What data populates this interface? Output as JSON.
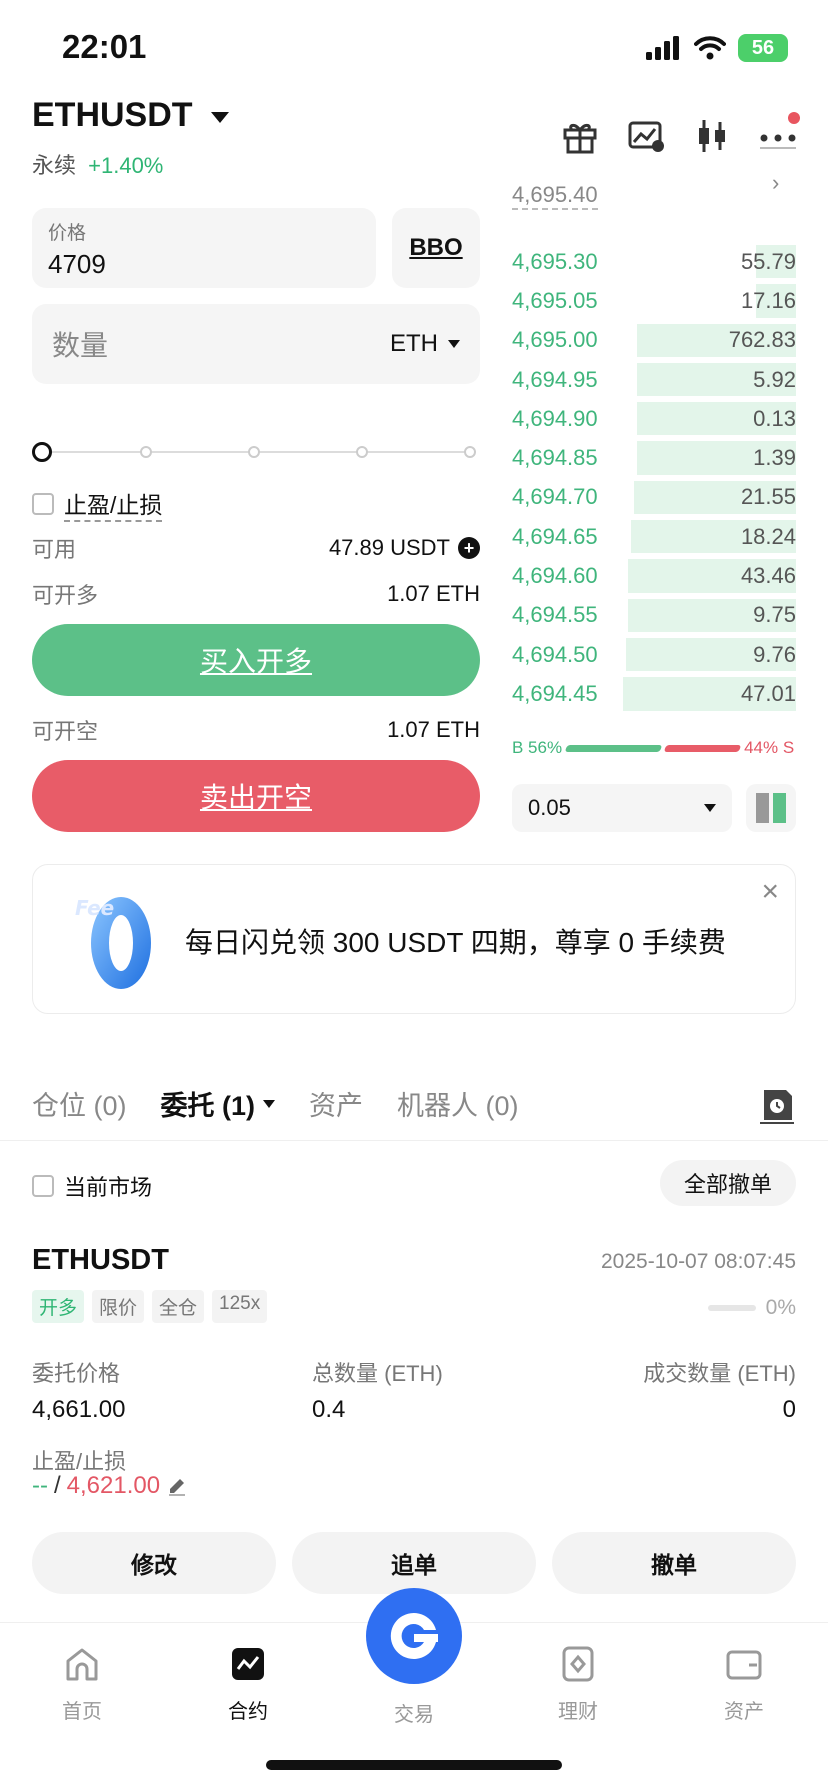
{
  "status": {
    "time": "22:01",
    "battery": "56"
  },
  "header": {
    "symbol": "ETHUSDT",
    "contract_type": "永续",
    "change": "+1.40%"
  },
  "order_form": {
    "price_label": "价格",
    "price_value": "4709",
    "bbo_label": "BBO",
    "qty_placeholder": "数量",
    "qty_unit": "ETH",
    "slider_percent": 0,
    "tpsl_label": "止盈/止损",
    "available_label": "可用",
    "available_value": "47.89 USDT",
    "max_long_label": "可开多",
    "max_long_value": "1.07 ETH",
    "buy_label": "买入开多",
    "max_short_label": "可开空",
    "max_short_value": "1.07 ETH",
    "sell_label": "卖出开空"
  },
  "orderbook": {
    "top_price": "4,695.40",
    "rows": [
      {
        "price": "4,695.30",
        "qty": "55.79",
        "depth": 0.14
      },
      {
        "price": "4,695.05",
        "qty": "17.16",
        "depth": 0.14
      },
      {
        "price": "4,695.00",
        "qty": "762.83",
        "depth": 0.56
      },
      {
        "price": "4,694.95",
        "qty": "5.92",
        "depth": 0.56
      },
      {
        "price": "4,694.90",
        "qty": "0.13",
        "depth": 0.56
      },
      {
        "price": "4,694.85",
        "qty": "1.39",
        "depth": 0.56
      },
      {
        "price": "4,694.70",
        "qty": "21.55",
        "depth": 0.57
      },
      {
        "price": "4,694.65",
        "qty": "18.24",
        "depth": 0.58
      },
      {
        "price": "4,694.60",
        "qty": "43.46",
        "depth": 0.59
      },
      {
        "price": "4,694.55",
        "qty": "9.75",
        "depth": 0.59
      },
      {
        "price": "4,694.50",
        "qty": "9.76",
        "depth": 0.6
      },
      {
        "price": "4,694.45",
        "qty": "47.01",
        "depth": 0.61
      }
    ],
    "buy_ratio_label": "B 56%",
    "sell_ratio_label": "44% S",
    "buy_ratio": 56,
    "sell_ratio": 44,
    "depth_value": "0.05"
  },
  "banner": {
    "text": "每日闪兑领 300 USDT 四期，尊享 0 手续费",
    "logo_text": "Fee"
  },
  "tabs": [
    {
      "label": "仓位 (0)"
    },
    {
      "label": "委托 (1)"
    },
    {
      "label": "资产"
    },
    {
      "label": "机器人 (0)"
    }
  ],
  "filter": {
    "current_market_label": "当前市场",
    "cancel_all_label": "全部撤单"
  },
  "order": {
    "symbol": "ETHUSDT",
    "time": "2025-10-07 08:07:45",
    "tags": [
      "开多",
      "限价",
      "全仓",
      "125x"
    ],
    "progress_label": "0%",
    "price_label": "委托价格",
    "price_value": "4,661.00",
    "total_label": "总数量 (ETH)",
    "total_value": "0.4",
    "filled_label": "成交数量 (ETH)",
    "filled_value": "0",
    "tpsl_label": "止盈/止损",
    "tp_value": "--",
    "sep": "/",
    "sl_value": "4,621.00",
    "actions": [
      "修改",
      "追单",
      "撤单"
    ]
  },
  "nav": {
    "items": [
      "首页",
      "合约",
      "交易",
      "理财",
      "资产"
    ]
  },
  "colors": {
    "green": "#5cc088",
    "red": "#e85c68",
    "brand_blue": "#2f6ff2"
  }
}
